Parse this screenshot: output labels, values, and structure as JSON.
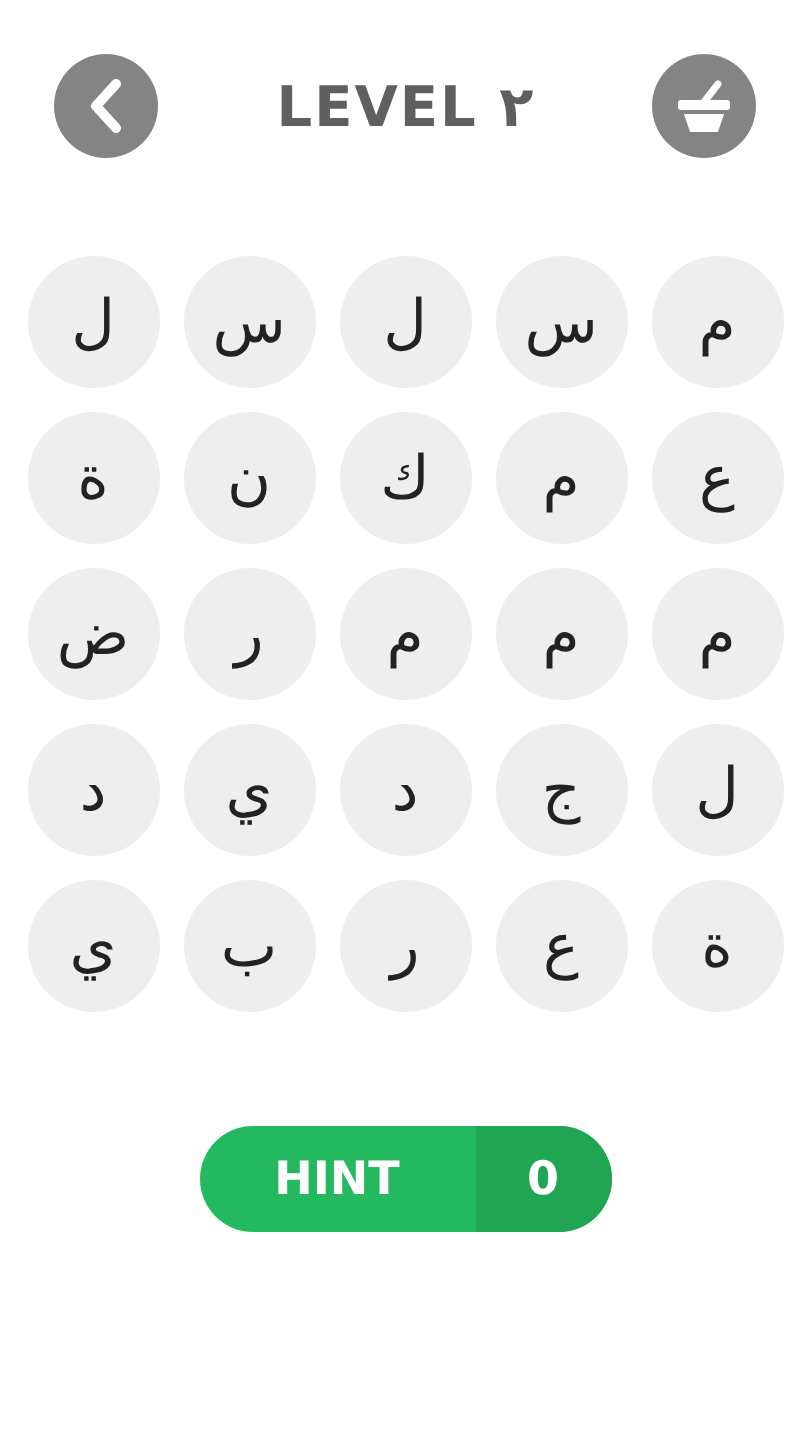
{
  "header": {
    "title": "LEVEL ٢"
  },
  "grid": [
    [
      "م",
      "س",
      "ل",
      "س",
      "ل"
    ],
    [
      "ع",
      "م",
      "ك",
      "ن",
      "ة"
    ],
    [
      "م",
      "م",
      "م",
      "ر",
      "ض"
    ],
    [
      "ل",
      "ج",
      "د",
      "ي",
      "د"
    ],
    [
      "ة",
      "ع",
      "ر",
      "ب",
      "ي"
    ]
  ],
  "hint": {
    "label": "HINT",
    "count": "0"
  }
}
